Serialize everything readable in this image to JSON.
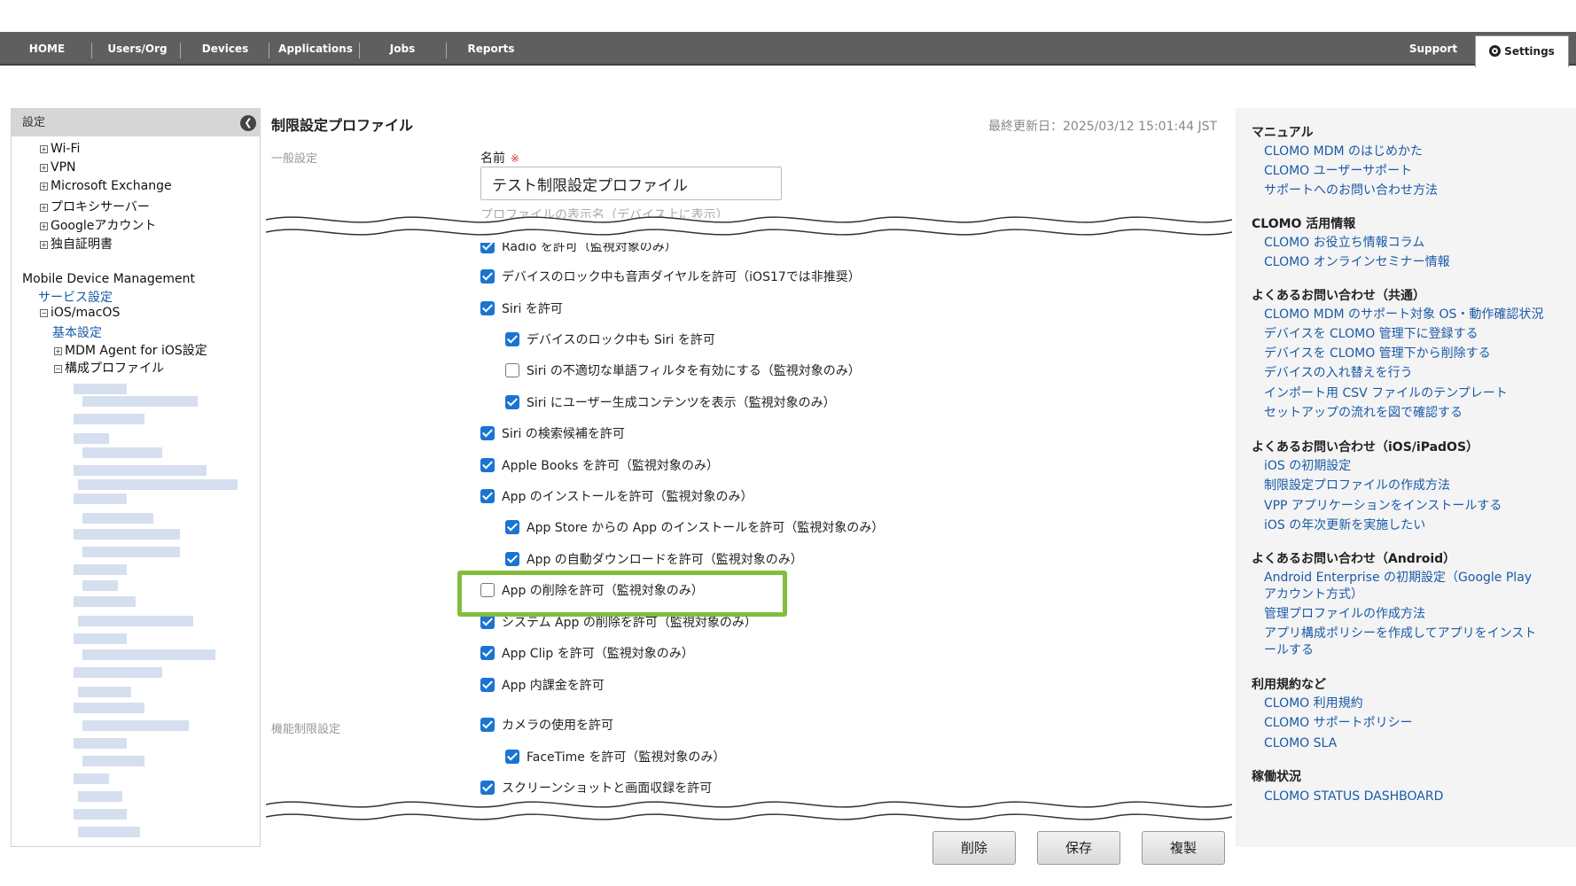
{
  "nav": {
    "items": [
      "HOME",
      "Users/Org",
      "Devices",
      "Applications",
      "Jobs",
      "Reports"
    ],
    "support": "Support",
    "settings": "Settings"
  },
  "sidebar": {
    "header": "設定",
    "profile_items": [
      "Wi-Fi",
      "VPN",
      "Microsoft Exchange",
      "プロキシサーバー",
      "Googleアカウント",
      "独自証明書"
    ],
    "mdm_title": "Mobile Device Management",
    "service_settings": "サービス設定",
    "ios_macos": "iOS/macOS",
    "basic_settings": "基本設定",
    "mdm_agent": "MDM Agent for iOS設定",
    "config_profile": "構成プロファイル"
  },
  "main": {
    "title": "制限設定プロファイル",
    "last_updated": "最終更新日：2025/03/12 15:01:44 JST",
    "section_general": "一般設定",
    "section_function": "機能制限設定",
    "name_label": "名前",
    "required_mark": "※",
    "name_value": "テスト制限設定プロファイル",
    "name_hint": "プロファイルの表示名（デバイス上に表示）",
    "checkboxes": [
      {
        "label": "Radio を許可（監視対象のみ）",
        "checked": true
      },
      {
        "label": "デバイスのロック中も音声ダイヤルを許可（iOS17では非推奨）",
        "checked": true
      },
      {
        "label": "Siri を許可",
        "checked": true
      },
      {
        "label": "デバイスのロック中も Siri を許可",
        "checked": true
      },
      {
        "label": "Siri の不適切な単語フィルタを有効にする（監視対象のみ）",
        "checked": false
      },
      {
        "label": "Siri にユーザー生成コンテンツを表示（監視対象のみ）",
        "checked": true
      },
      {
        "label": "Siri の検索候補を許可",
        "checked": true
      },
      {
        "label": "Apple Books を許可（監視対象のみ）",
        "checked": true
      },
      {
        "label": "App のインストールを許可（監視対象のみ）",
        "checked": true
      },
      {
        "label": "App Store からの App のインストールを許可（監視対象のみ）",
        "checked": true
      },
      {
        "label": "App の自動ダウンロードを許可（監視対象のみ）",
        "checked": true
      },
      {
        "label": "App の削除を許可（監視対象のみ）",
        "checked": false
      },
      {
        "label": "システム App の削除を許可（監視対象のみ）",
        "checked": true
      },
      {
        "label": "App Clip を許可（監視対象のみ）",
        "checked": true
      },
      {
        "label": "App 内課金を許可",
        "checked": true
      },
      {
        "label": "カメラの使用を許可",
        "checked": true
      },
      {
        "label": "FaceTime を許可（監視対象のみ）",
        "checked": true
      },
      {
        "label": "スクリーンショットと画面収録を許可",
        "checked": true
      }
    ],
    "buttons": {
      "delete": "削除",
      "save": "保存",
      "duplicate": "複製"
    }
  },
  "right": {
    "sections": [
      {
        "title": "マニュアル",
        "links": [
          "CLOMO MDM のはじめかた",
          "CLOMO ユーザーサポート",
          "サポートへのお問い合わせ方法"
        ]
      },
      {
        "title": "CLOMO 活用情報",
        "links": [
          "CLOMO お役立ち情報コラム",
          "CLOMO オンラインセミナー情報"
        ]
      },
      {
        "title": "よくあるお問い合わせ（共通）",
        "links": [
          "CLOMO MDM のサポート対象 OS・動作確認状況",
          "デバイスを CLOMO 管理下に登録する",
          "デバイスを CLOMO 管理下から削除する",
          "デバイスの入れ替えを行う",
          "インポート用 CSV ファイルのテンプレート",
          "セットアップの流れを図で確認する"
        ]
      },
      {
        "title": "よくあるお問い合わせ（iOS/iPadOS）",
        "links": [
          "iOS の初期設定",
          "制限設定プロファイルの作成方法",
          "VPP アプリケーションをインストールする",
          "iOS の年次更新を実施したい"
        ]
      },
      {
        "title": "よくあるお問い合わせ（Android）",
        "links": [
          "Android Enterprise の初期設定（Google Play アカウント方式）",
          "管理プロファイルの作成方法",
          "アプリ構成ポリシーを作成してアプリをインストールする"
        ]
      },
      {
        "title": "利用規約など",
        "links": [
          "CLOMO 利用規約",
          "CLOMO サポートポリシー",
          "CLOMO SLA"
        ]
      },
      {
        "title": "稼働状況",
        "links": [
          "CLOMO STATUS DASHBOARD"
        ]
      }
    ]
  }
}
